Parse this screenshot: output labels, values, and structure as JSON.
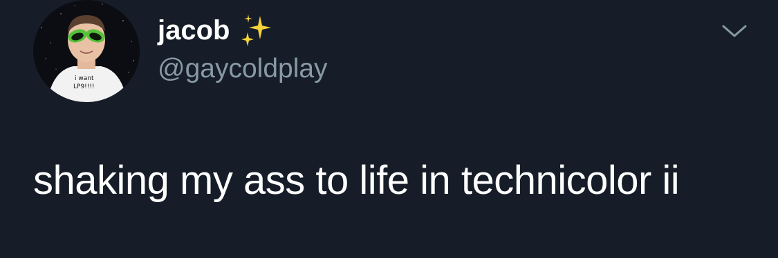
{
  "tweet": {
    "display_name": "jacob",
    "name_emoji": "sparkles-icon",
    "handle": "@gaycoldplay",
    "text": "shaking my ass to life in technicolor ii",
    "menu_icon": "chevron-down-icon",
    "avatar": {
      "shirt_text_line1": "i want",
      "shirt_text_line2": "LP9!!!!"
    }
  },
  "colors": {
    "background": "#161d28",
    "primary_text": "#ffffff",
    "secondary_text": "#8899a6",
    "sparkle": "#f5d33b",
    "alien_glasses": "#56c23a"
  }
}
